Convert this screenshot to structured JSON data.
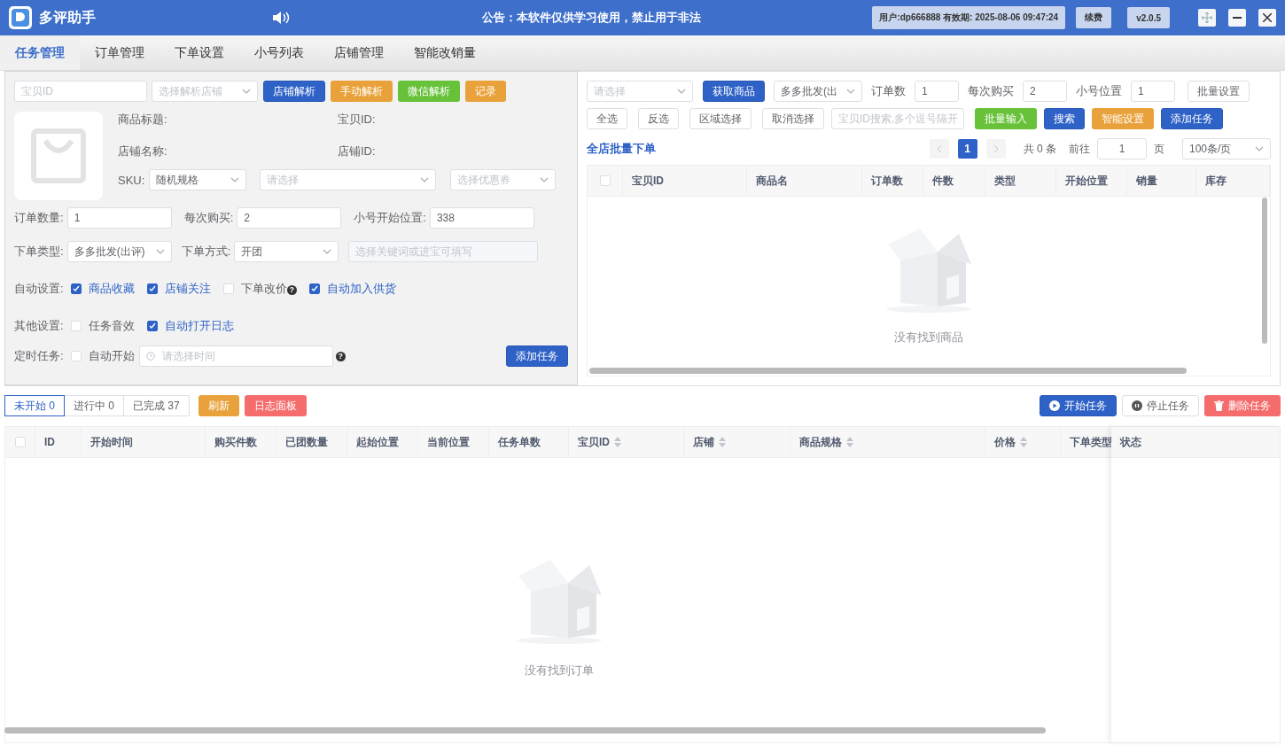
{
  "title_bar": {
    "app_name": "多评助手",
    "announcement": "公告：本软件仅供学习使用，禁止用于非法",
    "user_info": "用户:dp666888 有效期: 2025-08-06 09:47:24",
    "renew_button": "续费",
    "version": "v2.0.5"
  },
  "tabs": [
    {
      "label": "任务管理",
      "selected": true
    },
    {
      "label": "订单管理",
      "selected": false
    },
    {
      "label": "下单设置",
      "selected": false
    },
    {
      "label": "小号列表",
      "selected": false
    },
    {
      "label": "店铺管理",
      "selected": false
    },
    {
      "label": "智能改销量",
      "selected": false
    }
  ],
  "product_form": {
    "item_id_field": {
      "placeholder": "宝贝ID"
    },
    "shop_select": {
      "placeholder": "选择解析店铺"
    },
    "parse_buttons": [
      {
        "label": "店铺解析",
        "kind": "primary"
      },
      {
        "label": "手动解析",
        "kind": "warning"
      },
      {
        "label": "微信解析",
        "kind": "success"
      },
      {
        "label": "记录",
        "kind": "warning"
      }
    ],
    "info_labels": [
      "商品标题:",
      "宝贝ID:",
      "店铺名称:",
      "店铺ID:"
    ],
    "sku": {
      "label": "SKU:",
      "value": "随机规格",
      "spec_placeholder": "请选择",
      "coupon_placeholder": "选择优惠券"
    },
    "number_fields": [
      {
        "label": "订单数量:",
        "value": "1"
      },
      {
        "label": "每次购买:",
        "value": "2"
      },
      {
        "label": "小号开始位置:",
        "value": "338"
      }
    ],
    "order_type": {
      "label": "下单类型:",
      "value": "多多批发(出评)"
    },
    "order_method": {
      "label": "下单方式:",
      "value": "开团"
    },
    "keyword_field": {
      "placeholder": "选择关键词或进宝可填写"
    },
    "setting_rows": [
      {
        "label": "自动设置:",
        "options": [
          {
            "label": "商品收藏",
            "checked": true
          },
          {
            "label": "店铺关注",
            "checked": true
          },
          {
            "label": "下单改价",
            "checked": false,
            "help": "?"
          },
          {
            "label": "自动加入供货",
            "checked": true
          }
        ]
      },
      {
        "label": "其他设置:",
        "options": [
          {
            "label": "任务音效",
            "checked": false
          },
          {
            "label": "自动打开日志",
            "checked": true
          }
        ]
      }
    ],
    "timer": {
      "label": "定时任务:",
      "option": {
        "label": "自动开始",
        "checked": false
      },
      "time_placeholder": "请选择时间",
      "help": "?"
    },
    "add_task_button": "添加任务"
  },
  "batch_panel": {
    "category_select": {
      "placeholder": "请选择"
    },
    "fetch_button": "获取商品",
    "type_select": {
      "value": "多多批发(出"
    },
    "fields": [
      {
        "label": "订单数",
        "value": "1"
      },
      {
        "label": "每次购买",
        "value": "2"
      },
      {
        "label": "小号位置",
        "value": "1"
      }
    ],
    "batch_setting_button": "批量设置",
    "select_buttons": [
      "全选",
      "反选",
      "区域选择",
      "取消选择"
    ],
    "id_search": {
      "placeholder": "宝贝ID搜索,多个逗号隔开"
    },
    "action_buttons": [
      {
        "label": "批量输入",
        "kind": "success"
      },
      {
        "label": "搜索",
        "kind": "primary"
      },
      {
        "label": "智能设置",
        "kind": "warning"
      },
      {
        "label": "添加任务",
        "kind": "primary"
      }
    ],
    "title": "全店批量下单",
    "pagination": {
      "pages": [
        {
          "label": "1",
          "selected": true
        }
      ],
      "total": "共 0 条",
      "goto_label": "前往",
      "goto_value": "1",
      "page_unit": "页",
      "page_size": "100条/页"
    },
    "table": {
      "select_all_checked": false,
      "columns": [
        "宝贝ID",
        "商品名",
        "订单数",
        "件数",
        "类型",
        "开始位置",
        "销量",
        "库存"
      ],
      "empty_text": "没有找到商品"
    }
  },
  "task_area": {
    "status_tabs": [
      {
        "label": "未开始 0",
        "selected": true
      },
      {
        "label": "进行中 0",
        "selected": false
      },
      {
        "label": "已完成 37",
        "selected": false
      }
    ],
    "buttons": [
      {
        "label": "刷新",
        "kind": "warning"
      },
      {
        "label": "日志面板",
        "kind": "danger"
      }
    ],
    "task_buttons": [
      {
        "label": "开始任务",
        "kind": "primary"
      },
      {
        "label": "停止任务",
        "kind": "plain"
      },
      {
        "label": "删除任务",
        "kind": "danger"
      }
    ],
    "table": {
      "select_all_checked": false,
      "columns": [
        {
          "label": "ID",
          "sortable": false
        },
        {
          "label": "开始时间",
          "sortable": false
        },
        {
          "label": "购买件数",
          "sortable": false
        },
        {
          "label": "已团数量",
          "sortable": false
        },
        {
          "label": "起始位置",
          "sortable": false
        },
        {
          "label": "当前位置",
          "sortable": false
        },
        {
          "label": "任务单数",
          "sortable": false
        },
        {
          "label": "宝贝ID",
          "sortable": true
        },
        {
          "label": "店铺",
          "sortable": true
        },
        {
          "label": "商品规格",
          "sortable": true
        },
        {
          "label": "价格",
          "sortable": true
        },
        {
          "label": "下单类型"
        },
        {
          "label": "状态"
        }
      ],
      "empty_text": "没有找到订单"
    }
  }
}
